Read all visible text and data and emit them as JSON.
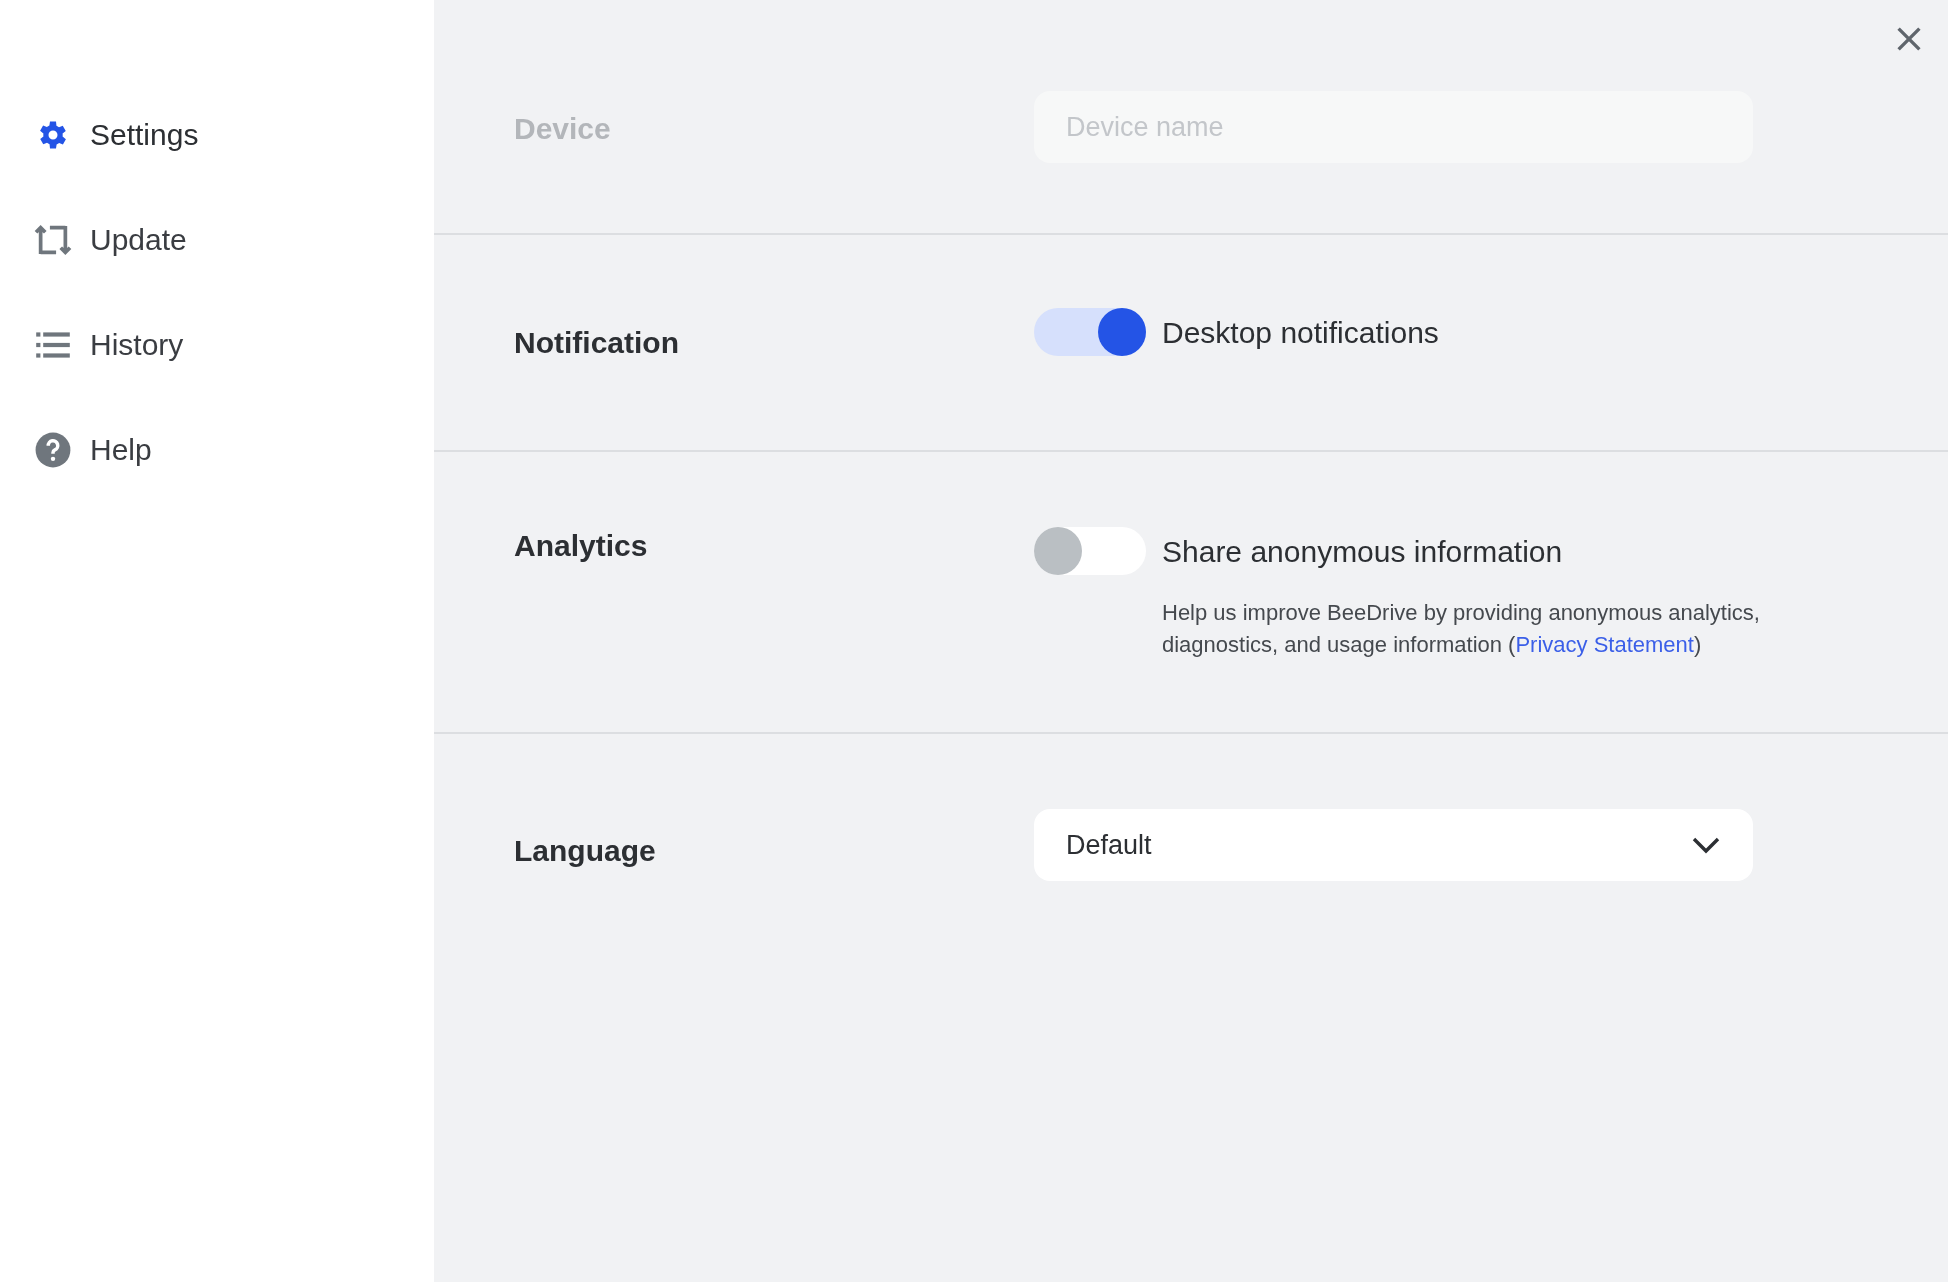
{
  "sidebar": {
    "items": [
      {
        "label": "Settings",
        "selected": true
      },
      {
        "label": "Update",
        "selected": false
      },
      {
        "label": "History",
        "selected": false
      },
      {
        "label": "Help",
        "selected": false
      }
    ]
  },
  "sections": [
    {
      "kind": "input",
      "label": "Device",
      "disabled": true,
      "placeholder": "Device name"
    },
    {
      "kind": "toggle",
      "label": "Notification",
      "toggle_label": "Desktop notifications",
      "on": true
    },
    {
      "kind": "toggle",
      "label": "Analytics",
      "toggle_label": "Share anonymous information",
      "on": false,
      "description": "Help us improve BeeDrive by providing anonymous analytics, diagnostics, and usage information (",
      "link": "Privacy Statement",
      "description_end": ")"
    },
    {
      "kind": "select",
      "label": "Language",
      "value": "Default"
    }
  ]
}
